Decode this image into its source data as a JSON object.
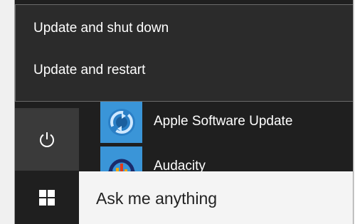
{
  "power_menu": {
    "items": [
      {
        "label": "Update and shut down"
      },
      {
        "label": "Update and restart"
      }
    ]
  },
  "start_menu": {
    "apps": [
      {
        "label": "Apple Software Update",
        "icon": "apple-software-update-icon"
      },
      {
        "label": "Audacity",
        "icon": "audacity-icon"
      }
    ]
  },
  "taskbar": {
    "search_placeholder": "Ask me anything"
  },
  "colors": {
    "menu_bg": "#2b2b2b",
    "start_bg": "#1f1f1f",
    "tile_accent": "#3a95d8"
  }
}
